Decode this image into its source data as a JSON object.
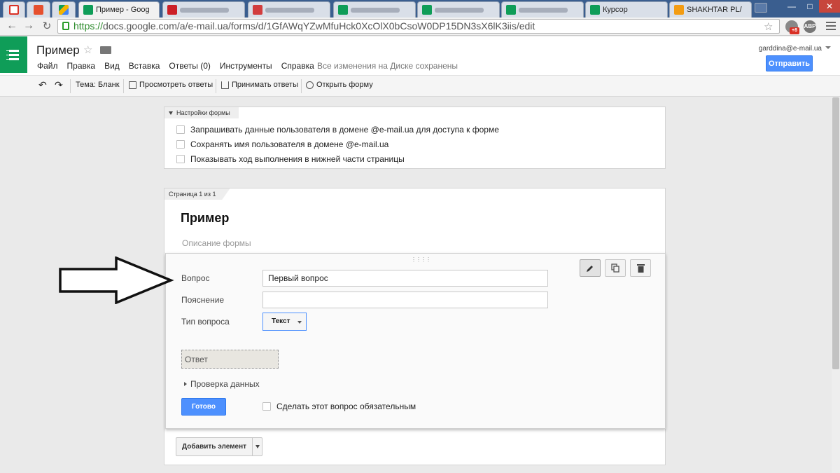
{
  "browser": {
    "tabs": [
      {
        "label": "",
        "favicon_color": "#d93025",
        "icon": "gmail-icon"
      },
      {
        "label": "",
        "favicon_color": "#e6502e",
        "icon": "blogger-icon"
      },
      {
        "label": "",
        "favicon_color": "#f4b400",
        "icon": "drive-icon"
      },
      {
        "label": "Пример - Goog",
        "favicon_color": "#0f9d58",
        "icon": "forms-icon",
        "active": true
      },
      {
        "label": "",
        "favicon_color": "#cc2027",
        "icon": "shop-icon"
      },
      {
        "label": "",
        "favicon_color": "#d23d3d",
        "icon": "app-icon"
      },
      {
        "label": "",
        "favicon_color": "#0f9d58",
        "icon": "sheets-icon"
      },
      {
        "label": "",
        "favicon_color": "#0f9d58",
        "icon": "sheets-icon"
      },
      {
        "label": "",
        "favicon_color": "#0f9d58",
        "icon": "sheets-icon"
      },
      {
        "label": "Курсор",
        "favicon_color": "#0f9d58",
        "icon": "sheets-icon"
      },
      {
        "label": "SHAKHTAR PL/",
        "favicon_color": "#f39c12",
        "icon": "shakhtar-icon"
      }
    ],
    "url_scheme": "https://",
    "url_rest": "docs.google.com/a/e-mail.ua/forms/d/1GfAWqYZwMfuHck0XcOlX0bCsoW0DP15DN3sX6lK3iis/edit",
    "ext_badge": "+8",
    "ext_abp": "ABP"
  },
  "app": {
    "doc_title": "Пример",
    "menu": [
      "Файл",
      "Правка",
      "Вид",
      "Вставка",
      "Ответы (0)",
      "Инструменты",
      "Справка"
    ],
    "saved_status": "Все изменения на Диске сохранены",
    "user_email": "garddina@e-mail.ua",
    "send_label": "Отправить"
  },
  "toolbar": {
    "theme": "Тема: Бланк",
    "view_responses": "Просмотреть ответы",
    "accept_responses": "Принимать ответы",
    "open_form": "Открыть форму"
  },
  "settings": {
    "header": "Настройки формы",
    "options": [
      {
        "label": "Запрашивать данные пользователя в домене @e-mail.ua для доступа к форме",
        "checked": false
      },
      {
        "label": "Сохранять имя пользователя в домене @e-mail.ua",
        "checked": false
      },
      {
        "label": "Показывать ход выполнения в нижней части страницы",
        "checked": false
      }
    ]
  },
  "form": {
    "page_label": "Страница 1 из 1",
    "title": "Пример",
    "description_placeholder": "Описание формы",
    "question": {
      "question_label": "Вопрос",
      "question_value": "Первый вопрос",
      "help_label": "Пояснение",
      "help_value": "",
      "type_label": "Тип вопроса",
      "type_value": "Текст",
      "answer_placeholder": "Ответ",
      "validation_label": "Проверка данных",
      "done_label": "Готово",
      "required_label": "Сделать этот вопрос обязательным",
      "required_checked": false
    },
    "add_item_label": "Добавить элемент"
  }
}
